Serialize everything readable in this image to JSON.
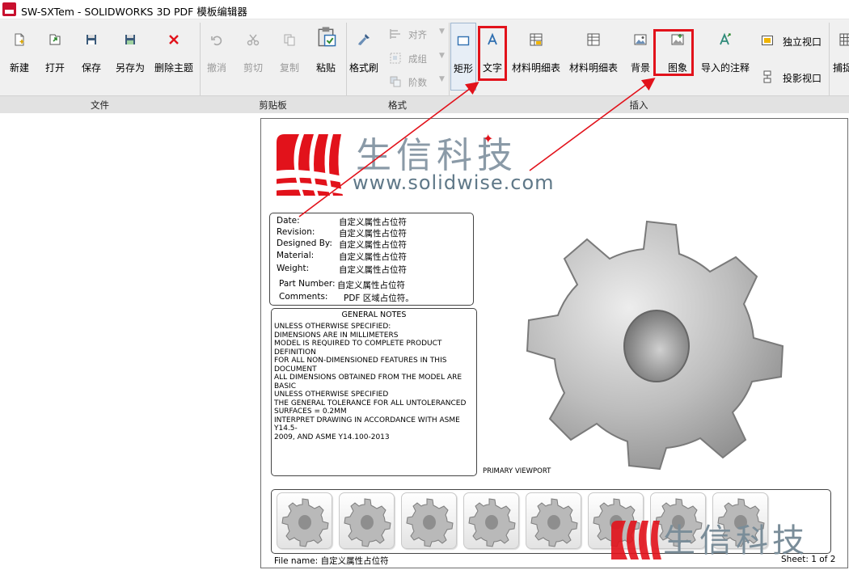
{
  "window": {
    "title": "SW-SXTem - SOLIDWORKS 3D PDF 模板编辑器",
    "icon": "solidworks-3dpdf-app-icon"
  },
  "ribbon": {
    "groups": [
      {
        "label": "文件"
      },
      {
        "label": "剪贴板"
      },
      {
        "label": "格式"
      },
      {
        "label": "插入"
      }
    ],
    "file": [
      {
        "label": "新建",
        "icon": "new-file-icon"
      },
      {
        "label": "打开",
        "icon": "open-folder-icon"
      },
      {
        "label": "保存",
        "icon": "save-disk-icon"
      },
      {
        "label": "另存为",
        "icon": "save-as-icon"
      },
      {
        "label": "删除主题",
        "icon": "delete-x-icon"
      }
    ],
    "clipboard": [
      {
        "label": "撤消",
        "icon": "undo-icon",
        "enabled": false
      },
      {
        "label": "剪切",
        "icon": "cut-icon",
        "enabled": false
      },
      {
        "label": "复制",
        "icon": "copy-icon",
        "enabled": false
      },
      {
        "label": "粘贴",
        "icon": "paste-icon",
        "enabled": true
      }
    ],
    "format": {
      "painter": {
        "label": "格式刷",
        "icon": "format-painter-icon"
      },
      "small": [
        {
          "label": "对齐",
          "icon": "align-icon",
          "enabled": false
        },
        {
          "label": "成组",
          "icon": "group-icon",
          "enabled": false
        },
        {
          "label": "阶数",
          "icon": "order-icon",
          "enabled": false
        }
      ]
    },
    "insert": [
      {
        "label": "矩形",
        "icon": "rectangle-icon",
        "selected": true
      },
      {
        "label": "文字",
        "icon": "text-a-icon",
        "highlighted": true
      },
      {
        "label": "材料明细表",
        "icon": "bom-table-icon"
      },
      {
        "label": "材料明细表",
        "icon": "bom-table-icon"
      },
      {
        "label": "背景",
        "icon": "background-image-icon"
      },
      {
        "label": "图象",
        "icon": "image-icon",
        "highlighted": true
      },
      {
        "label": "导入的注释",
        "icon": "imported-annotation-icon"
      }
    ],
    "insert_side": [
      {
        "label": "独立视口",
        "icon": "standalone-viewport-icon"
      },
      {
        "label": "投影视口",
        "icon": "projected-viewport-icon"
      }
    ],
    "overflow": {
      "label": "捕捉",
      "icon": "snap-grid-icon"
    }
  },
  "template": {
    "logo": {
      "brand_cn": "生信科技",
      "url": "www.solidwise.com",
      "accent": "#e2121b",
      "text_color": "#8a9aa7"
    },
    "properties": [
      {
        "key": "Date:",
        "value": "自定义属性占位符"
      },
      {
        "key": "Revision:",
        "value": "自定义属性占位符"
      },
      {
        "key": "Designed By:",
        "value": "自定义属性占位符"
      },
      {
        "key": "Material:",
        "value": "自定义属性占位符"
      },
      {
        "key": "Weight:",
        "value": "自定义属性占位符"
      },
      {
        "key": "Part Number:",
        "value": "自定义属性占位符"
      },
      {
        "key": "Comments:",
        "value": "PDF 区域占位符。"
      }
    ],
    "notes": {
      "title": "GENERAL NOTES",
      "lines": [
        "UNLESS OTHERWISE SPECIFIED:",
        "DIMENSIONS ARE IN MILLIMETERS",
        "MODEL IS REQUIRED TO COMPLETE PRODUCT",
        "DEFINITION",
        "FOR ALL NON-DIMENSIONED FEATURES IN THIS",
        "DOCUMENT",
        "ALL DIMENSIONS OBTAINED FROM THE MODEL ARE",
        "BASIC",
        "UNLESS OTHERWISE SPECIFIED",
        "THE GENERAL TOLERANCE FOR ALL UNTOLERANCED",
        "SURFACES = 0.2MM",
        "INTERPRET DRAWING IN ACCORDANCE WITH ASME",
        "Y14.5-",
        "2009, AND ASME Y14.100-2013"
      ]
    },
    "viewport_label": "PRIMARY VIEWPORT",
    "thumbnail_count": 8,
    "footer": {
      "file_name_label": "File name:",
      "file_name_value": "自定义属性占位符",
      "sheet": "Sheet: 1 of 2"
    },
    "watermark_cn": "生信科技"
  },
  "colors": {
    "highlight": "#e2121b",
    "ribbon_bg": "#f0f0f0",
    "group_bar": "#e2e2e2"
  }
}
